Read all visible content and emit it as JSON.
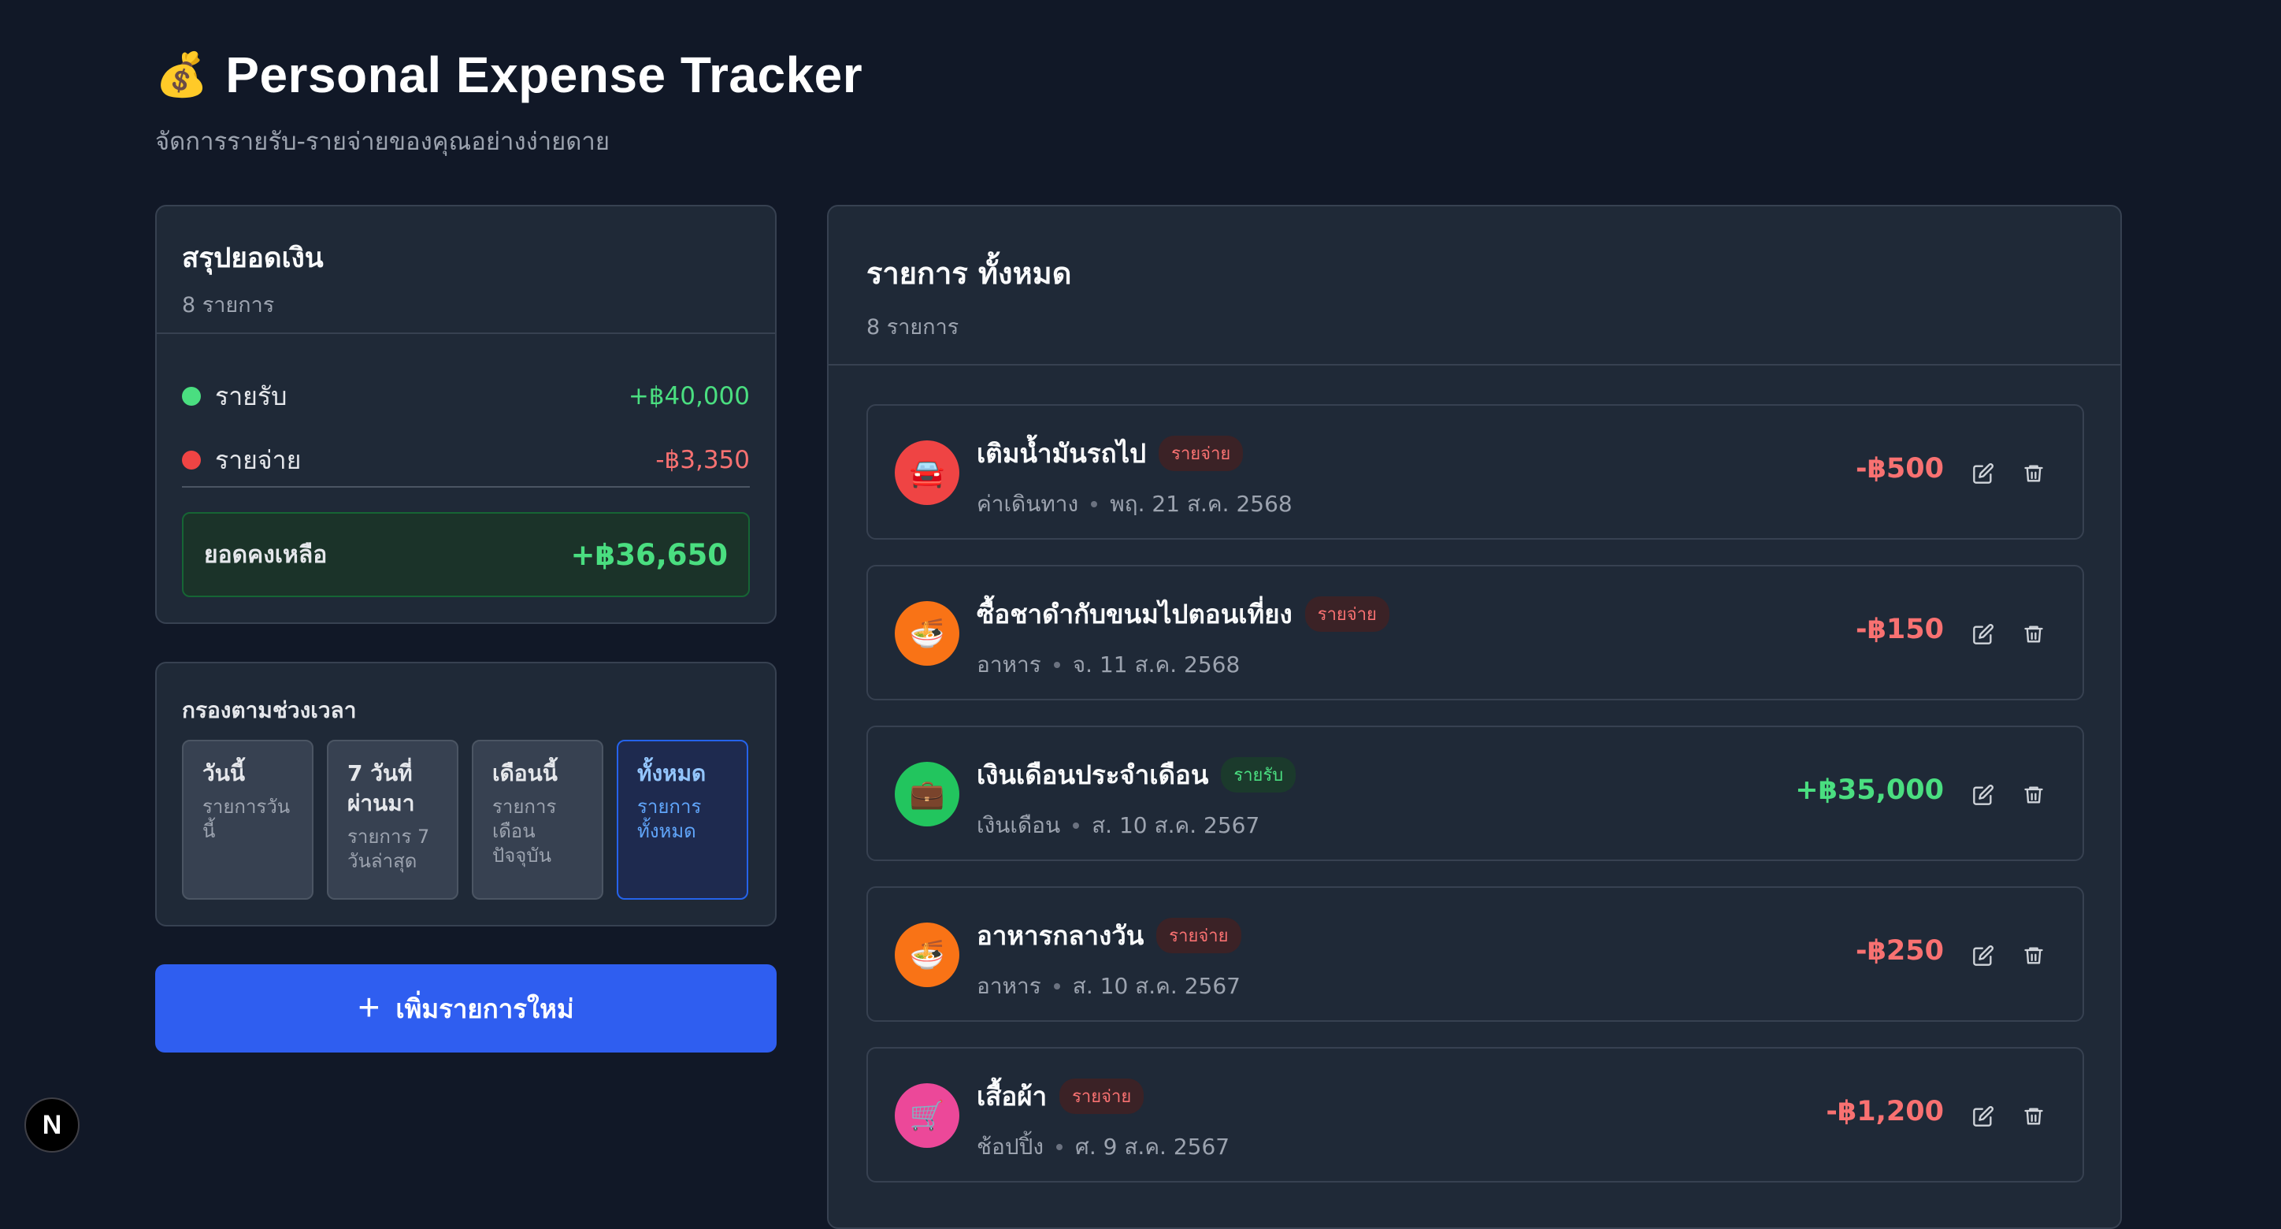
{
  "header": {
    "emoji": "💰",
    "title": "Personal Expense Tracker",
    "subtitle": "จัดการรายรับ-รายจ่ายของคุณอย่างง่ายดาย"
  },
  "summary": {
    "title": "สรุปยอดเงิน",
    "count": "8 รายการ",
    "income_label": "รายรับ",
    "income_value": "+฿40,000",
    "expense_label": "รายจ่าย",
    "expense_value": "-฿3,350",
    "balance_label": "ยอดคงเหลือ",
    "balance_value": "+฿36,650"
  },
  "filter": {
    "title": "กรองตามช่วงเวลา",
    "options": [
      {
        "label": "วันนี้",
        "desc": "รายการวันนี้"
      },
      {
        "label": "7 วันที่ผ่านมา",
        "desc": "รายการ 7 วันล่าสุด"
      },
      {
        "label": "เดือนนี้",
        "desc": "รายการเดือนปัจจุบัน"
      },
      {
        "label": "ทั้งหมด",
        "desc": "รายการทั้งหมด"
      }
    ],
    "selected": "ทั้งหมด"
  },
  "add_button": "เพิ่มรายการใหม่",
  "list": {
    "title": "รายการ ทั้งหมด",
    "count": "8 รายการ",
    "items": [
      {
        "icon": "car-icon",
        "glyph": "🚘",
        "name": "เติมน้ำมันรถไป",
        "type": "รายจ่าย",
        "category": "ค่าเดินทาง",
        "date": "พฤ. 21 ส.ค. 2568",
        "amount": "-฿500"
      },
      {
        "icon": "food-icon",
        "glyph": "🍜",
        "name": "ซื้อชาดำกับขนมไปตอนเที่ยง",
        "type": "รายจ่าย",
        "category": "อาหาร",
        "date": "จ. 11 ส.ค. 2568",
        "amount": "-฿150"
      },
      {
        "icon": "briefcase-icon",
        "glyph": "💼",
        "name": "เงินเดือนประจำเดือน",
        "type": "รายรับ",
        "category": "เงินเดือน",
        "date": "ส. 10 ส.ค. 2567",
        "amount": "+฿35,000"
      },
      {
        "icon": "food-icon",
        "glyph": "🍜",
        "name": "อาหารกลางวัน",
        "type": "รายจ่าย",
        "category": "อาหาร",
        "date": "ส. 10 ส.ค. 2567",
        "amount": "-฿250"
      },
      {
        "icon": "shopping-cart-icon",
        "glyph": "🛒",
        "name": "เสื้อผ้า",
        "type": "รายจ่าย",
        "category": "ช้อปปิ้ง",
        "date": "ศ. 9 ส.ค. 2567",
        "amount": "-฿1,200"
      }
    ]
  },
  "colors": {
    "income": "#4ade80",
    "expense": "#f87171",
    "accent": "#2f5ef0",
    "icon_car": "#ef4444",
    "icon_food": "#f97316",
    "icon_salary": "#22c55e",
    "icon_shopping": "#ec4899"
  },
  "nextjs_badge": "N"
}
